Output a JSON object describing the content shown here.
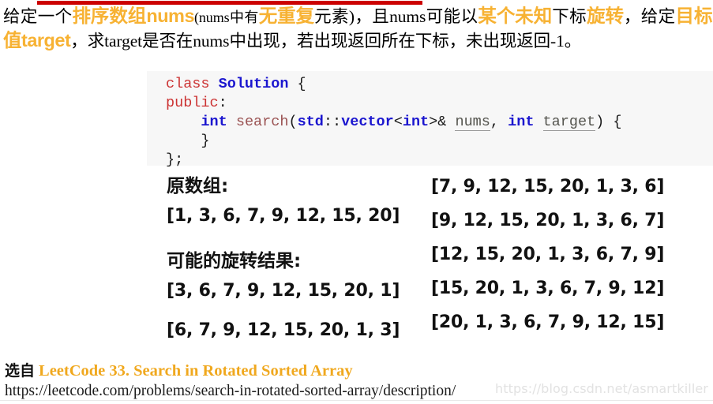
{
  "statement": {
    "seg1": "给定一个",
    "seg2_hl": "排序数组nums",
    "seg3": "(nums中有",
    "seg4_hl": "无重复",
    "seg5": "元素)，且nums可能以",
    "seg6_hl": "某个未知",
    "seg7": "下标",
    "seg8_hl": "旋转",
    "seg9": "，给定",
    "seg10_hl": "目标值target",
    "seg11": "，求target是否在nums中出现，若出现返回所在下标，未出现返回-1。",
    "highlight_color": "#f7b233"
  },
  "code": {
    "language": "C++",
    "background": "#f7f7f7",
    "lines": [
      {
        "tokens": [
          {
            "t": "class ",
            "c": "kw"
          },
          {
            "t": "Solution",
            "c": "type"
          },
          {
            "t": " {",
            "c": "pl"
          }
        ]
      },
      {
        "tokens": [
          {
            "t": "public",
            "c": "kw"
          },
          {
            "t": ":",
            "c": "pl"
          }
        ]
      },
      {
        "tokens": [
          {
            "t": "    ",
            "c": "pl"
          },
          {
            "t": "int",
            "c": "type"
          },
          {
            "t": " ",
            "c": "pl"
          },
          {
            "t": "search",
            "c": "fn"
          },
          {
            "t": "(",
            "c": "pl"
          },
          {
            "t": "std",
            "c": "ns"
          },
          {
            "t": "::",
            "c": "pl"
          },
          {
            "t": "vector",
            "c": "ns"
          },
          {
            "t": "<",
            "c": "pl"
          },
          {
            "t": "int",
            "c": "type"
          },
          {
            "t": ">& ",
            "c": "pl"
          },
          {
            "t": "nums",
            "c": "pn"
          },
          {
            "t": ", ",
            "c": "pl"
          },
          {
            "t": "int",
            "c": "type"
          },
          {
            "t": " ",
            "c": "pl"
          },
          {
            "t": "target",
            "c": "pn"
          },
          {
            "t": ") {",
            "c": "pl"
          }
        ]
      },
      {
        "tokens": [
          {
            "t": "    }",
            "c": "pl"
          }
        ]
      },
      {
        "tokens": [
          {
            "t": "};",
            "c": "pl"
          }
        ]
      }
    ]
  },
  "arrays": {
    "original_label": "原数组:",
    "original": "[1, 3, 6, 7, 9, 12, 15, 20]",
    "rotations_label": "可能的旋转结果:",
    "rotations_left": [
      "[3, 6, 7, 9, 12, 15, 20, 1]",
      "[6, 7, 9, 12, 15, 20, 1, 3]"
    ],
    "rotations_right": [
      "[7, 9, 12, 15, 20, 1, 3, 6]",
      "[9, 12, 15, 20, 1, 3, 6, 7]",
      "[12, 15, 20, 1, 3, 6, 7, 9]",
      "[15, 20, 1, 3, 6, 7, 9, 12]",
      "[20, 1, 3, 6, 7, 9, 12, 15]"
    ]
  },
  "footer": {
    "source_prefix": "选自",
    "source_title": "LeetCode 33. Search in Rotated Sorted Array",
    "source_url": "https://leetcode.com/problems/search-in-rotated-sorted-array/description/",
    "watermark": "https://blog.csdn.net/asmartkiller",
    "accent_color": "#f0a81e"
  }
}
